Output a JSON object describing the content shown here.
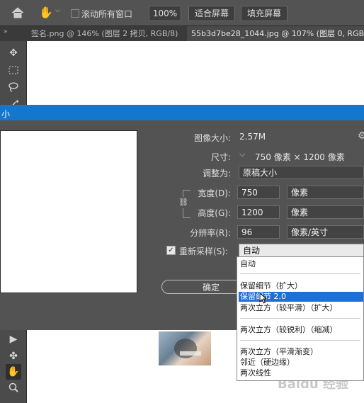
{
  "options_bar": {
    "scroll_all_windows_label": "滚动所有窗口",
    "zoom_value": "100%",
    "fit_screen_label": "适合屏幕",
    "fill_screen_label": "填充屏幕"
  },
  "tabs": [
    {
      "label": "签名.png @ 146% (图层 2 拷贝, RGB/8) *",
      "close": "×"
    },
    {
      "label": "55b3d7be28_1044.jpg @ 107% (图层 0, RGB/8#)",
      "close": "×"
    }
  ],
  "dialog": {
    "title": "小",
    "image_size_label": "图像大小:",
    "image_size_value": "2.57M",
    "dimensions_label": "尺寸:",
    "dimensions_value": "750 像素 × 1200 像素",
    "fit_to_label": "调整为:",
    "fit_to_value": "原稿大小",
    "width_label": "宽度(D):",
    "width_value": "750",
    "width_unit": "像素",
    "height_label": "高度(G):",
    "height_value": "1200",
    "height_unit": "像素",
    "resolution_label": "分辨率(R):",
    "resolution_value": "96",
    "resolution_unit": "像素/英寸",
    "resample_label": "重新采样(S):",
    "resample_value": "自动",
    "ok_label": "确定"
  },
  "resample_options": [
    "自动",
    "保留细节（扩大）",
    "保留细节 2.0",
    "两次立方（较平滑）（扩大）",
    "两次立方（较锐利）（缩减）",
    "两次立方（平滑渐变）",
    "邻近（硬边缘）",
    "两次线性"
  ],
  "resample_selected_index": 2,
  "watermark": "Baidu 经验"
}
